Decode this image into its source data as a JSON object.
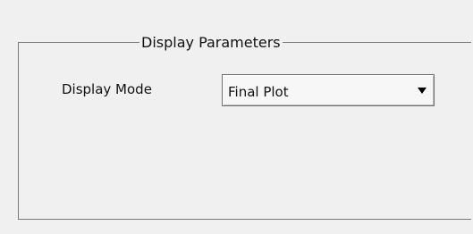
{
  "panel": {
    "title": "Display Parameters"
  },
  "display_mode": {
    "label": "Display Mode",
    "selected": "Final Plot"
  },
  "icons": {
    "dropdown": "chevron-down-icon"
  }
}
